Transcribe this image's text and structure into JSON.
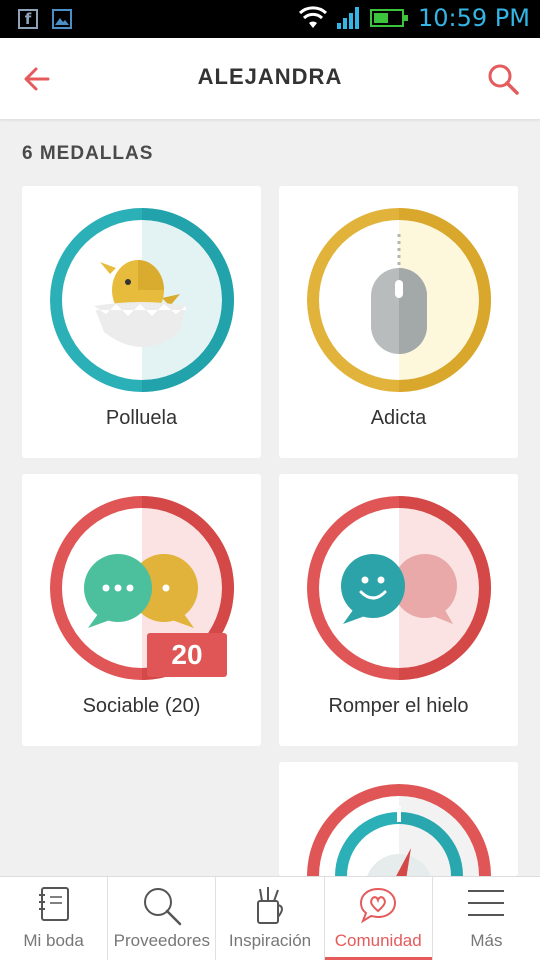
{
  "status_bar": {
    "time": "10:59 PM"
  },
  "header": {
    "title": "ALEJANDRA"
  },
  "section": {
    "title": "6 MEDALLAS"
  },
  "medals": [
    {
      "label": "Polluela",
      "color": "#2bb0b8"
    },
    {
      "label": "Adicta",
      "color": "#e2b33a"
    },
    {
      "label": "Sociable (20)",
      "color": "#e05555",
      "badge": "20"
    },
    {
      "label": "Romper el hielo",
      "color": "#e05555"
    }
  ],
  "bottom_nav": [
    {
      "label": "Mi boda",
      "icon": "notebook-icon"
    },
    {
      "label": "Proveedores",
      "icon": "search-icon"
    },
    {
      "label": "Inspiración",
      "icon": "cup-icon"
    },
    {
      "label": "Comunidad",
      "icon": "heart-chat-icon",
      "active": true
    },
    {
      "label": "Más",
      "icon": "menu-icon"
    }
  ],
  "colors": {
    "accent": "#e55a5a",
    "teal": "#2bb0b8",
    "gold": "#e2b33a",
    "red": "#e05555"
  }
}
